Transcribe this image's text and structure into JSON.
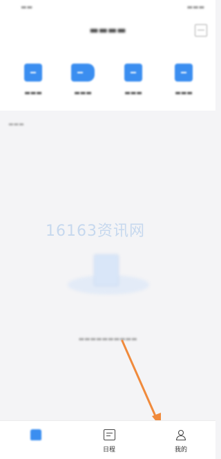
{
  "watermark": "16163资讯网",
  "tabs": [
    {
      "label": "",
      "icon": "home-icon"
    },
    {
      "label": "日程",
      "icon": "calendar-icon"
    },
    {
      "label": "我的",
      "icon": "user-icon"
    }
  ],
  "colors": {
    "accent": "#3b8ef0",
    "annotation_arrow": "#f08a3c",
    "background": "#f4f4f6"
  }
}
